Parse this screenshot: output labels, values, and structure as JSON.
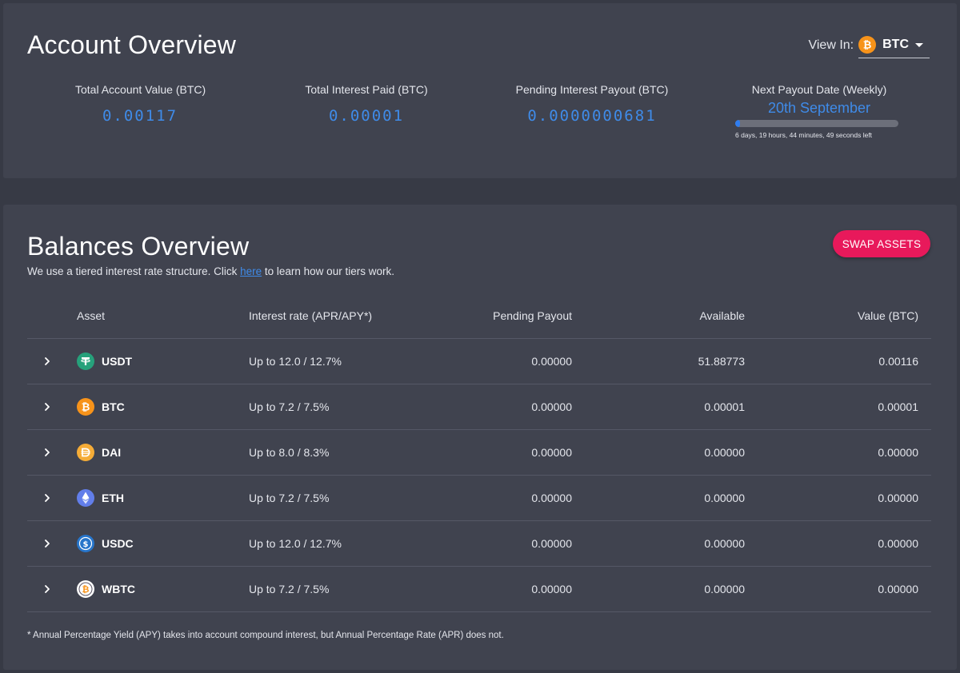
{
  "account": {
    "title": "Account Overview",
    "view_in_label": "View In:",
    "view_in_currency": "BTC",
    "view_in_icon": "btc-icon",
    "stats": {
      "total_value_label": "Total Account Value (BTC)",
      "total_value": "0.00117",
      "interest_paid_label": "Total Interest Paid (BTC)",
      "interest_paid": "0.00001",
      "pending_label": "Pending Interest Payout (BTC)",
      "pending": "0.0000000681"
    },
    "payout": {
      "label": "Next Payout Date (Weekly)",
      "date": "20th September",
      "progress": 0.03,
      "countdown": "6 days, 19 hours, 44 minutes, 49 seconds left"
    }
  },
  "balances": {
    "title": "Balances Overview",
    "subtitle_before": "We use a tiered interest rate structure. Click ",
    "subtitle_link": "here",
    "subtitle_after": " to learn how our tiers work.",
    "swap_label": "SWAP ASSETS",
    "headers": {
      "asset": "Asset",
      "rate": "Interest rate (APR/APY*)",
      "pending": "Pending Payout",
      "available": "Available",
      "value": "Value (BTC)"
    },
    "rows": [
      {
        "asset": "USDT",
        "icon": "usdt-icon",
        "rate": "Up to 12.0 / 12.7%",
        "pending": "0.00000",
        "available": "51.88773",
        "value": "0.00116"
      },
      {
        "asset": "BTC",
        "icon": "btc-icon",
        "rate": "Up to 7.2 / 7.5%",
        "pending": "0.00000",
        "available": "0.00001",
        "value": "0.00001"
      },
      {
        "asset": "DAI",
        "icon": "dai-icon",
        "rate": "Up to 8.0 / 8.3%",
        "pending": "0.00000",
        "available": "0.00000",
        "value": "0.00000"
      },
      {
        "asset": "ETH",
        "icon": "eth-icon",
        "rate": "Up to 7.2 / 7.5%",
        "pending": "0.00000",
        "available": "0.00000",
        "value": "0.00000"
      },
      {
        "asset": "USDC",
        "icon": "usdc-icon",
        "rate": "Up to 12.0 / 12.7%",
        "pending": "0.00000",
        "available": "0.00000",
        "value": "0.00000"
      },
      {
        "asset": "WBTC",
        "icon": "wbtc-icon",
        "rate": "Up to 7.2 / 7.5%",
        "pending": "0.00000",
        "available": "0.00000",
        "value": "0.00000"
      }
    ],
    "footnote": "* Annual Percentage Yield (APY) takes into account compound interest, but Annual Percentage Rate (APR) does not."
  },
  "colors": {
    "accent_blue": "#3f8be8",
    "swap_pink": "#e8195b",
    "btc": "#f7931a",
    "usdt": "#26a17b",
    "dai": "#f5ac37",
    "eth": "#627eea",
    "usdc": "#2775ca"
  }
}
